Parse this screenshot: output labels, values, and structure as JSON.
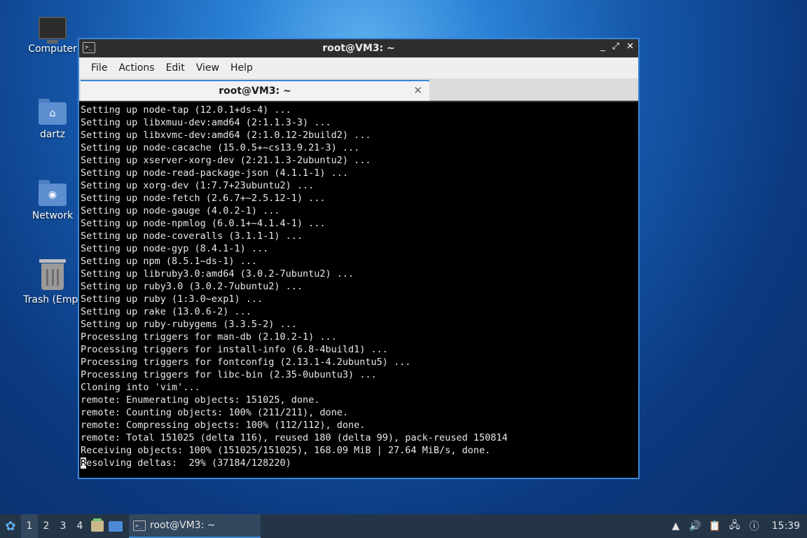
{
  "desktop": {
    "icons": [
      {
        "label": "Computer",
        "icon": "computer-icon"
      },
      {
        "label": "dartz",
        "icon": "home-folder-icon"
      },
      {
        "label": "Network",
        "icon": "network-folder-icon"
      },
      {
        "label": "Trash (Empt",
        "icon": "trash-icon"
      }
    ]
  },
  "window": {
    "title": "root@VM3: ~",
    "controls": {
      "minimize": "_",
      "maximize": "⤢",
      "close": "✕"
    },
    "menu": [
      "File",
      "Actions",
      "Edit",
      "View",
      "Help"
    ],
    "tab": {
      "label": "root@VM3: ~",
      "close": "✕"
    }
  },
  "terminal": {
    "lines": [
      "Setting up node-tap (12.0.1+ds-4) ...",
      "Setting up libxmuu-dev:amd64 (2:1.1.3-3) ...",
      "Setting up libxvmc-dev:amd64 (2:1.0.12-2build2) ...",
      "Setting up node-cacache (15.0.5+~cs13.9.21-3) ...",
      "Setting up xserver-xorg-dev (2:21.1.3-2ubuntu2) ...",
      "Setting up node-read-package-json (4.1.1-1) ...",
      "Setting up xorg-dev (1:7.7+23ubuntu2) ...",
      "Setting up node-fetch (2.6.7+~2.5.12-1) ...",
      "Setting up node-gauge (4.0.2-1) ...",
      "Setting up node-npmlog (6.0.1+~4.1.4-1) ...",
      "Setting up node-coveralls (3.1.1-1) ...",
      "Setting up node-gyp (8.4.1-1) ...",
      "Setting up npm (8.5.1~ds-1) ...",
      "Setting up libruby3.0:amd64 (3.0.2-7ubuntu2) ...",
      "Setting up ruby3.0 (3.0.2-7ubuntu2) ...",
      "Setting up ruby (1:3.0~exp1) ...",
      "Setting up rake (13.0.6-2) ...",
      "Setting up ruby-rubygems (3.3.5-2) ...",
      "Processing triggers for man-db (2.10.2-1) ...",
      "Processing triggers for install-info (6.8-4build1) ...",
      "Processing triggers for fontconfig (2.13.1-4.2ubuntu5) ...",
      "Processing triggers for libc-bin (2.35-0ubuntu3) ...",
      "Cloning into 'vim'...",
      "remote: Enumerating objects: 151025, done.",
      "remote: Counting objects: 100% (211/211), done.",
      "remote: Compressing objects: 100% (112/112), done.",
      "remote: Total 151025 (delta 116), reused 180 (delta 99), pack-reused 150814",
      "Receiving objects: 100% (151025/151025), 168.09 MiB | 27.64 MiB/s, done."
    ],
    "last_line_cursor_char": "R",
    "last_line_rest": "esolving deltas:  29% (37184/128220)"
  },
  "taskbar": {
    "workspaces": [
      "1",
      "2",
      "3",
      "4"
    ],
    "active_workspace": "1",
    "task_label": "root@VM3: ~",
    "tray_icons": [
      "arrow-up-icon",
      "volume-icon",
      "clipboard-icon",
      "network-icon",
      "update-icon"
    ],
    "clock": "15:39"
  }
}
